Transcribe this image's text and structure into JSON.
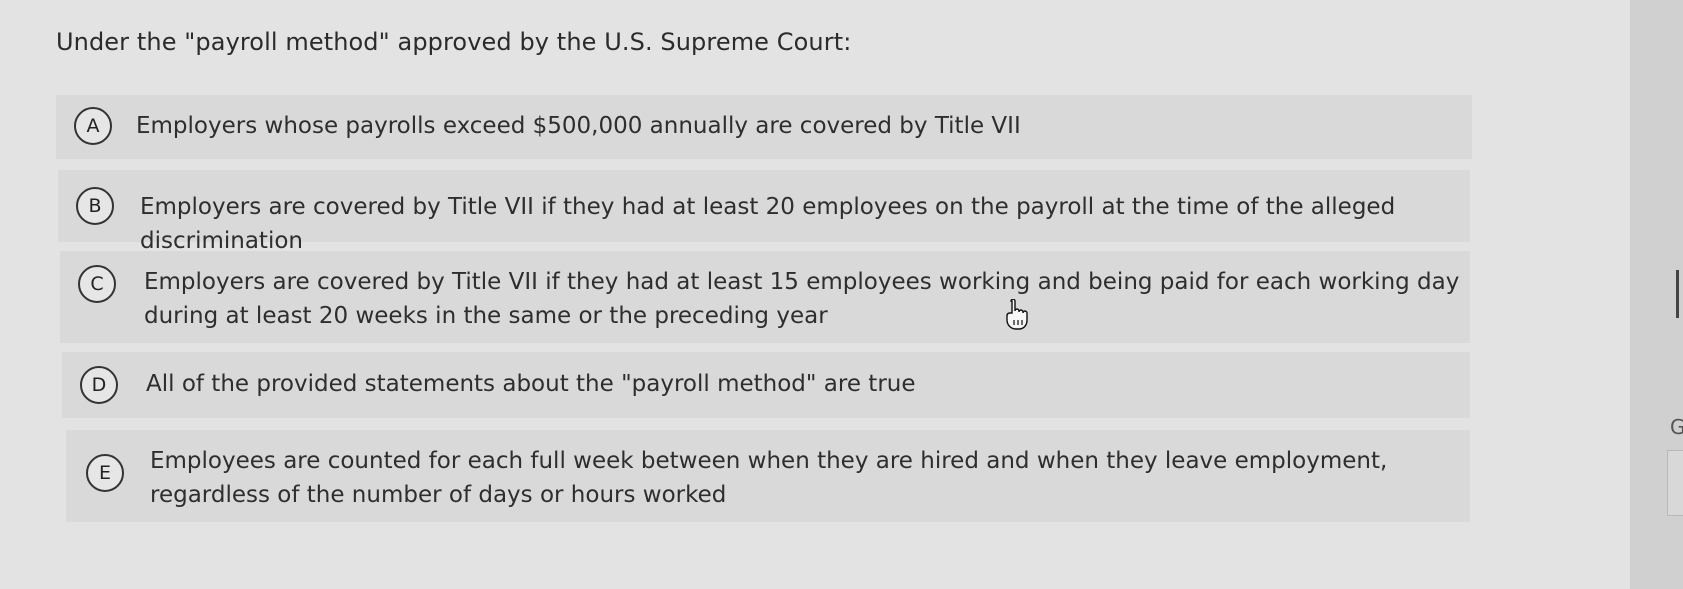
{
  "question": {
    "text": "Under the \"payroll method\" approved by the U.S. Supreme Court:"
  },
  "options": [
    {
      "label": "A",
      "text": "Employers whose payrolls exceed $500,000 annually are covered by Title VII"
    },
    {
      "label": "B",
      "text": "Employers are covered by Title VII if they had at least 20 employees on the payroll at the time of the alleged discrimination"
    },
    {
      "label": "C",
      "text": "Employers are covered by Title VII if they had at least 15 employees working and being paid for each working day during at least 20 weeks in the same or the preceding year"
    },
    {
      "label": "D",
      "text": "All of the provided statements about the \"payroll method\" are true"
    },
    {
      "label": "E",
      "text": "Employees are counted for each full week between when they are hired and when they leave employment, regardless of the number of days or hours worked"
    }
  ],
  "colors": {
    "page_bg": "#e3e3e3",
    "option_bg": "#d9d9d9",
    "text": "#2e2e2e"
  }
}
